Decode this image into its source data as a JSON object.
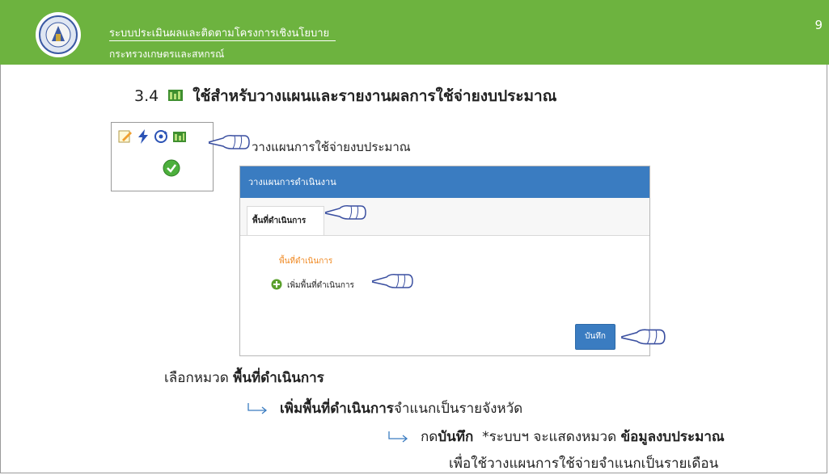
{
  "header": {
    "title": "ระบบประเมินผลและติดตามโครงการเชิงนโยบาย",
    "subtitle": "กระทรวงเกษตรและสหกรณ์",
    "page_number": "9"
  },
  "heading": {
    "number": "3.4",
    "text": "ใช้สำหรับวางแผนและรายงานผลการใช้จ่ายงบประมาณ",
    "icon": "budget-chart-icon"
  },
  "toolbar_icons": [
    "edit-icon",
    "lightning-icon",
    "refresh-icon",
    "budget-chart-icon",
    "check-circle-icon"
  ],
  "plan_label": "วางแผนการใช้จ่ายงบประมาณ",
  "dialog": {
    "title": "วางแผนการดำเนินงาน",
    "tab_label": "พื้นที่ดำเนินการ",
    "section_title": "พื้นที่ดำเนินการ",
    "add_label": "เพิ่มพื้นที่ดำเนินการ",
    "save_label": "บันทึก"
  },
  "instructions": {
    "l1_prefix": "เลือกหมวด ",
    "l1_bold": "พื้นที่ดำเนินการ",
    "l2_bold": "เพิ่มพื้นที่ดำเนินการ",
    "l2_rest": " จำแนกเป็นรายจังหวัด",
    "l3_prefix": "กด ",
    "l3_bold1": "บันทึก",
    "l3_mid": "  *ระบบฯ จะแสดงหมวด ",
    "l3_bold2": "ข้อมูลงบประมาณ",
    "l4": "เพื่อใช้วางแผนการใช้จ่ายจำแนกเป็นรายเดือน"
  },
  "colors": {
    "header_green": "#6db33f",
    "dialog_blue": "#3a7cc1",
    "section_orange": "#f08a24"
  }
}
